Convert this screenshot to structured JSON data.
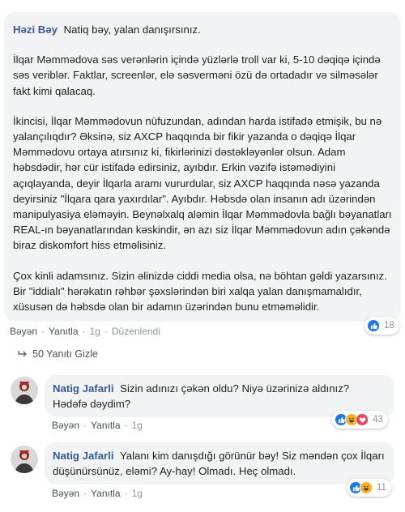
{
  "main_comment": {
    "author": "Həzi Bəy",
    "first_line": "Natiq bəy, yalan danışırsınız.",
    "paragraphs": [
      "İlqar Məmmədova səs verənlərin içində yüzlərlə troll var ki, 5-10 dəqiqə içində səs veriblər. Faktlar, screenlər, elə səsverməni özü də ortadadır və silməsələr fakt kimi qalacaq.",
      "İkincisi, İlqar Məmmədovun nüfuzundan, adından harda istifadə etmişik, bu nə yalançılıqdır? Əksinə, siz AXCP haqqında bir fikir yazanda o dəqiqə İlqar Məmmədovu ortaya atırsınız ki, fikirlərinizi dəstəkləyənlər olsun. Adam həbsdədir, hər cür istifadə edirsiniz, ayıbdır. Erkin vəzifə istəmədiyini açıqlayanda, deyir İlqarla aramı vururdular, siz AXCP haqqında nəsə yazanda deyirsiniz \"İlqara qara yaxırdılar\". Ayıbdır. Həbsdə olan insanın adı üzərindən manipulyasiya eləməyin. Beynəlxalq aləmin İlqar Məmmədovla bağlı bəyanatları REAL-ın bəyanatlarından kəskindir, ən azı siz İlqar Məmmədovun adın çəkəndə biraz diskomfort hiss etməlisiniz.",
      "Çox kinli adamsınız. Sizin əlinizdə ciddi media olsa, nə böhtan gəldi yazarsınız. Bir \"iddialı\" hərəkatın rəhbər şəxslərindən biri xalqa yalan danışmamalıdır, xüsusən də həbsdə olan bir adamın üzərindən bunu etməməlidir."
    ],
    "actions": {
      "like": "Bəyən",
      "reply": "Yanıtla",
      "time": "1g",
      "edited": "Düzenlendi"
    },
    "reaction_count": "18"
  },
  "replies_toggle": "50 Yanıtı Gizle",
  "replies": [
    {
      "author": "Natig Jafarli",
      "text": "Sizin adınızı çəkən oldu? Niyə üzərinizə aldınız? Hədəfə dəydim?",
      "actions": {
        "like": "Bəyən",
        "reply": "Yanıtla",
        "time": "1g"
      },
      "reaction_count": "43"
    },
    {
      "author": "Natig Jafarli",
      "text": "Yalanı kim danışdığı görünür bəy! Siz məndən çox İlqarı düşünürsünüz, eləmi? Ay-hay! Olmadı. Heç olmadı.",
      "actions": {
        "like": "Bəyən",
        "reply": "Yanıtla",
        "time": "1g"
      },
      "reaction_count": "11"
    }
  ],
  "colors": {
    "like_blue": "#1877f2",
    "haha_yellow": "#f7b125",
    "love_red": "#f33e58",
    "author_link": "#385898"
  }
}
